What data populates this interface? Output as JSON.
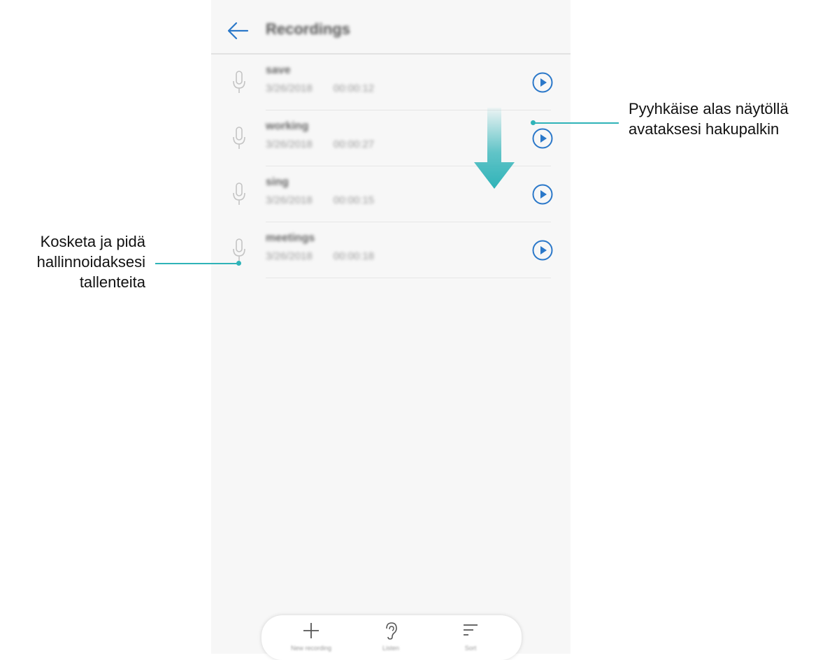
{
  "appbar": {
    "title": "Recordings"
  },
  "recordings": [
    {
      "name": "save",
      "date": "3/26/2018",
      "duration": "00:00:12"
    },
    {
      "name": "working",
      "date": "3/26/2018",
      "duration": "00:00:27"
    },
    {
      "name": "sing",
      "date": "3/26/2018",
      "duration": "00:00:15"
    },
    {
      "name": "meetings",
      "date": "3/26/2018",
      "duration": "00:00:18"
    }
  ],
  "bottom_bar": [
    {
      "icon": "plus-icon",
      "label": "New recording"
    },
    {
      "icon": "ear-icon",
      "label": "Listen"
    },
    {
      "icon": "sort-icon",
      "label": "Sort"
    }
  ],
  "callouts": {
    "right": {
      "line1": "Pyyhkäise alas näytöllä",
      "line2": "avataksesi hakupalkin"
    },
    "left": {
      "line1": "Kosketa ja pidä",
      "line2": "hallinnoidaksesi",
      "line3": "tallenteita"
    }
  },
  "colors": {
    "accent": "#2b78c9",
    "callout": "#2fb3b8",
    "background": "#f7f7f7"
  }
}
